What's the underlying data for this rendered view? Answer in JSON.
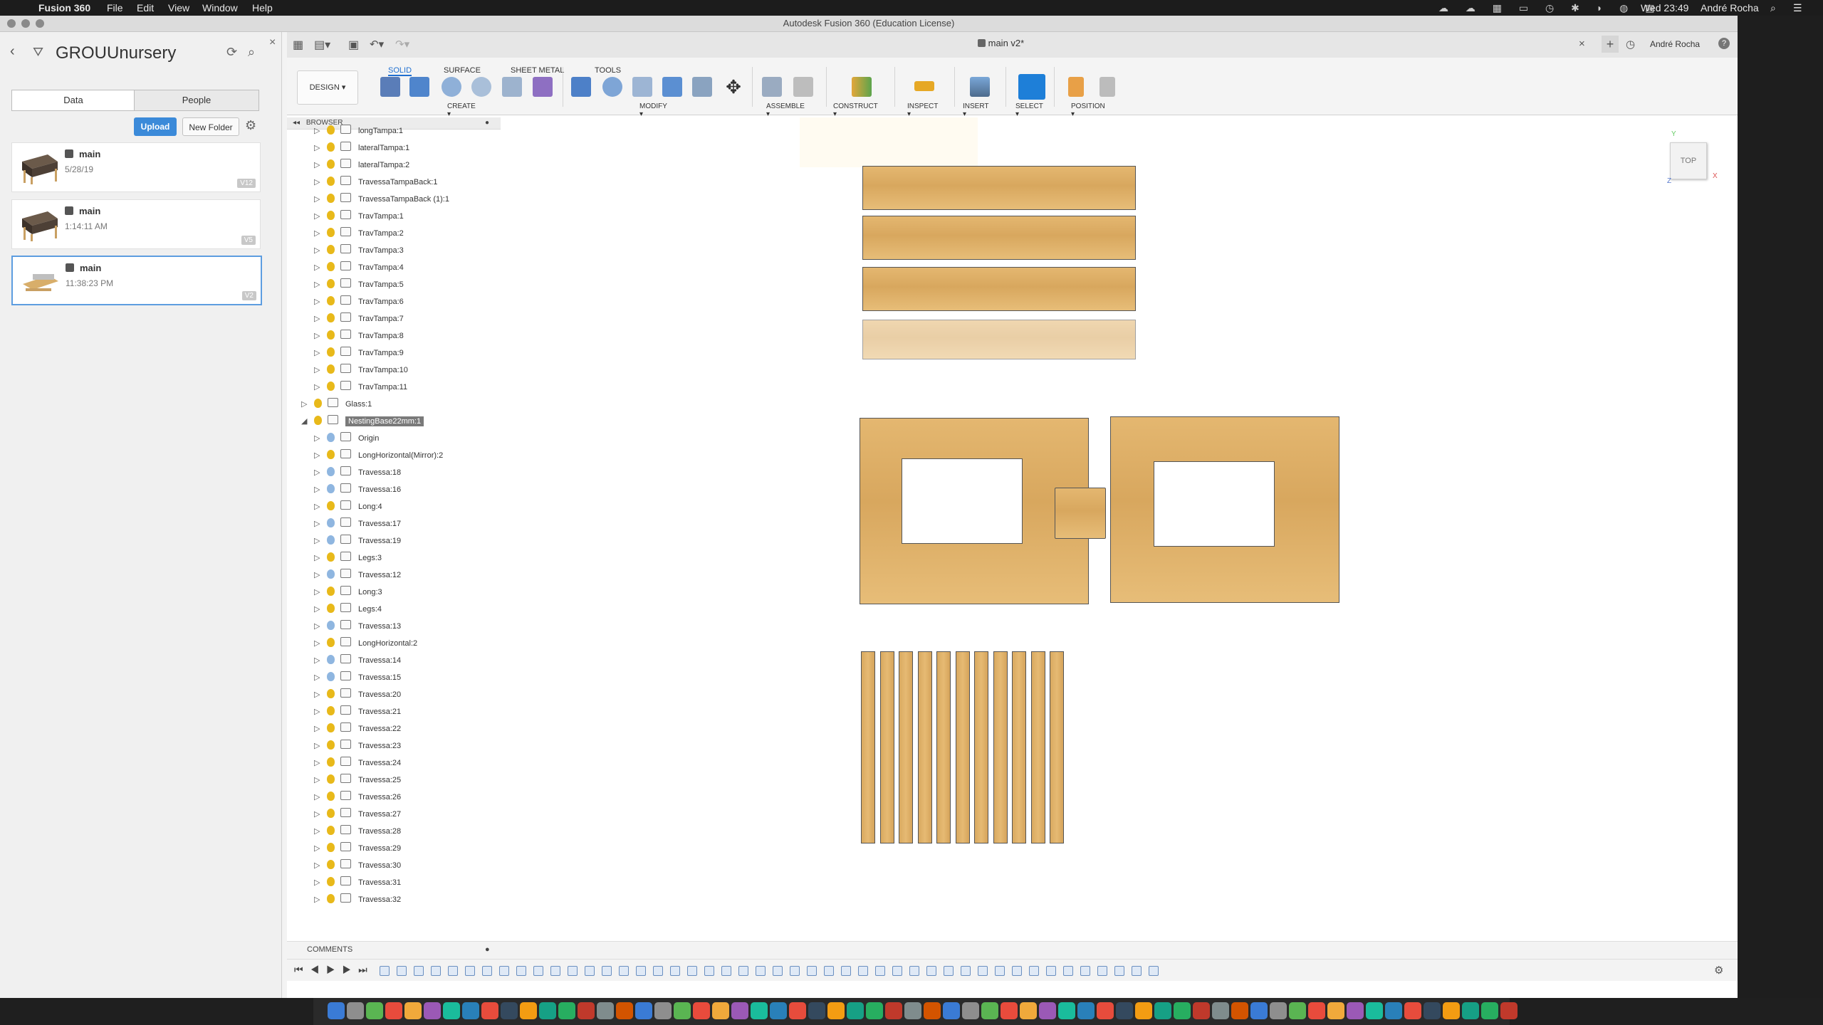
{
  "menubar": {
    "app_name": "Fusion 360",
    "menus": [
      "File",
      "Edit",
      "View",
      "Window",
      "Help"
    ],
    "clock": "Wed 23:49",
    "user": "André Rocha"
  },
  "window": {
    "title": "Autodesk Fusion 360 (Education License)"
  },
  "data_panel": {
    "project": "GROUUnursery",
    "tabs": [
      "Data",
      "People"
    ],
    "upload_label": "Upload",
    "new_folder_label": "New Folder",
    "items": [
      {
        "name": "main",
        "date": "5/28/19",
        "version": "V12"
      },
      {
        "name": "main",
        "date": "1:14:11 AM",
        "version": "V5"
      },
      {
        "name": "main",
        "date": "11:38:23 PM",
        "version": "V2"
      }
    ]
  },
  "document": {
    "tab_title": "main v2*",
    "user": "André Rocha"
  },
  "toolbar": {
    "workspace": "DESIGN",
    "tabs": [
      "SOLID",
      "SURFACE",
      "SHEET METAL",
      "TOOLS"
    ],
    "groups": [
      "CREATE",
      "MODIFY",
      "ASSEMBLE",
      "CONSTRUCT",
      "INSPECT",
      "INSERT",
      "SELECT",
      "POSITION"
    ]
  },
  "browser": {
    "title": "BROWSER",
    "rows": [
      {
        "label": "longTampa:1",
        "level": 2,
        "bulb": "on"
      },
      {
        "label": "lateralTampa:1",
        "level": 2,
        "bulb": "on"
      },
      {
        "label": "lateralTampa:2",
        "level": 2,
        "bulb": "on"
      },
      {
        "label": "TravessaTampaBack:1",
        "level": 2,
        "bulb": "on"
      },
      {
        "label": "TravessaTampaBack (1):1",
        "level": 2,
        "bulb": "on"
      },
      {
        "label": "TravTampa:1",
        "level": 2,
        "bulb": "on"
      },
      {
        "label": "TravTampa:2",
        "level": 2,
        "bulb": "on"
      },
      {
        "label": "TravTampa:3",
        "level": 2,
        "bulb": "on"
      },
      {
        "label": "TravTampa:4",
        "level": 2,
        "bulb": "on"
      },
      {
        "label": "TravTampa:5",
        "level": 2,
        "bulb": "on"
      },
      {
        "label": "TravTampa:6",
        "level": 2,
        "bulb": "on"
      },
      {
        "label": "TravTampa:7",
        "level": 2,
        "bulb": "on"
      },
      {
        "label": "TravTampa:8",
        "level": 2,
        "bulb": "on"
      },
      {
        "label": "TravTampa:9",
        "level": 2,
        "bulb": "on"
      },
      {
        "label": "TravTampa:10",
        "level": 2,
        "bulb": "on"
      },
      {
        "label": "TravTampa:11",
        "level": 2,
        "bulb": "on"
      },
      {
        "label": "Glass:1",
        "level": 1,
        "bulb": "on"
      },
      {
        "label": "NestingBase22mm:1",
        "level": 1,
        "bulb": "on",
        "highlight": true
      },
      {
        "label": "Origin",
        "level": 2,
        "bulb": "off"
      },
      {
        "label": "LongHorizontal(Mirror):2",
        "level": 2,
        "bulb": "on"
      },
      {
        "label": "Travessa:18",
        "level": 2,
        "bulb": "off"
      },
      {
        "label": "Travessa:16",
        "level": 2,
        "bulb": "off"
      },
      {
        "label": "Long:4",
        "level": 2,
        "bulb": "on"
      },
      {
        "label": "Travessa:17",
        "level": 2,
        "bulb": "off"
      },
      {
        "label": "Travessa:19",
        "level": 2,
        "bulb": "off"
      },
      {
        "label": "Legs:3",
        "level": 2,
        "bulb": "on"
      },
      {
        "label": "Travessa:12",
        "level": 2,
        "bulb": "off"
      },
      {
        "label": "Long:3",
        "level": 2,
        "bulb": "on"
      },
      {
        "label": "Legs:4",
        "level": 2,
        "bulb": "on"
      },
      {
        "label": "Travessa:13",
        "level": 2,
        "bulb": "off"
      },
      {
        "label": "LongHorizontal:2",
        "level": 2,
        "bulb": "on"
      },
      {
        "label": "Travessa:14",
        "level": 2,
        "bulb": "off"
      },
      {
        "label": "Travessa:15",
        "level": 2,
        "bulb": "off"
      },
      {
        "label": "Travessa:20",
        "level": 2,
        "bulb": "on"
      },
      {
        "label": "Travessa:21",
        "level": 2,
        "bulb": "on"
      },
      {
        "label": "Travessa:22",
        "level": 2,
        "bulb": "on"
      },
      {
        "label": "Travessa:23",
        "level": 2,
        "bulb": "on"
      },
      {
        "label": "Travessa:24",
        "level": 2,
        "bulb": "on"
      },
      {
        "label": "Travessa:25",
        "level": 2,
        "bulb": "on"
      },
      {
        "label": "Travessa:26",
        "level": 2,
        "bulb": "on"
      },
      {
        "label": "Travessa:27",
        "level": 2,
        "bulb": "on"
      },
      {
        "label": "Travessa:28",
        "level": 2,
        "bulb": "on"
      },
      {
        "label": "Travessa:29",
        "level": 2,
        "bulb": "on"
      },
      {
        "label": "Travessa:30",
        "level": 2,
        "bulb": "on"
      },
      {
        "label": "Travessa:31",
        "level": 2,
        "bulb": "on"
      },
      {
        "label": "Travessa:32",
        "level": 2,
        "bulb": "on"
      }
    ]
  },
  "viewcube": {
    "face": "TOP"
  },
  "comments": {
    "title": "COMMENTS"
  },
  "colors": {
    "accent": "#1f6fd0",
    "wood": "#dcae66",
    "upload": "#3b8ad9"
  }
}
